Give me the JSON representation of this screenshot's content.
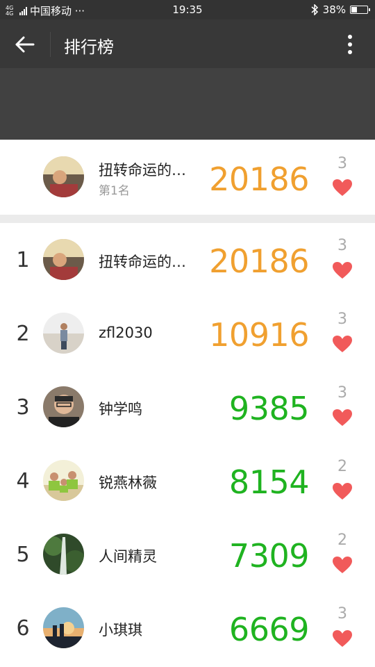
{
  "status_bar": {
    "network": "4G 4G",
    "carrier": "中国移动 ···",
    "time": "19:35",
    "bluetooth_icon": "bluetooth-icon",
    "battery_percent": "38%",
    "battery_level": 0.38
  },
  "toolbar": {
    "back_icon": "arrow-left-icon",
    "title": "排行榜",
    "more_icon": "more-vertical-icon"
  },
  "my_rank": {
    "name": "扭转命运的…",
    "rank_label": "第1名",
    "steps": "20186",
    "likes": "3"
  },
  "colors": {
    "orange": "#f0a030",
    "green": "#1fb320",
    "heart": "#f15a5a"
  },
  "rankings": [
    {
      "rank": "1",
      "name": "扭转命运的…",
      "steps": "20186",
      "likes": "3",
      "color": "#f0a030"
    },
    {
      "rank": "2",
      "name": "zfl2030",
      "steps": "10916",
      "likes": "3",
      "color": "#f0a030"
    },
    {
      "rank": "3",
      "name": "钟学鸣",
      "steps": "9385",
      "likes": "3",
      "color": "#1fb320"
    },
    {
      "rank": "4",
      "name": "锐燕林薇",
      "steps": "8154",
      "likes": "2",
      "color": "#1fb320"
    },
    {
      "rank": "5",
      "name": "人间精灵",
      "steps": "7309",
      "likes": "2",
      "color": "#1fb320"
    },
    {
      "rank": "6",
      "name": "小琪琪",
      "steps": "6669",
      "likes": "3",
      "color": "#1fb320"
    }
  ]
}
